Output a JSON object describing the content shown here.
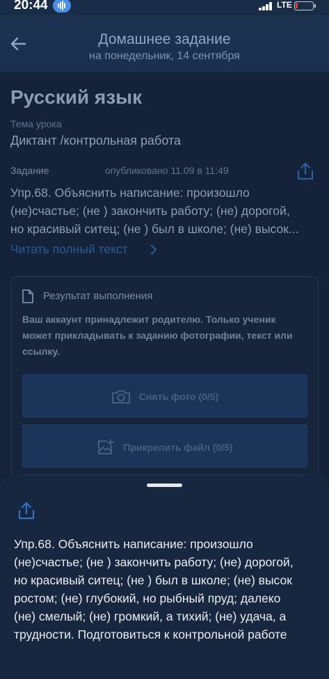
{
  "status": {
    "time": "20:44",
    "network": "LTE"
  },
  "header": {
    "title": "Домашнее задание",
    "subtitle": "на понедельник, 14 сентября"
  },
  "lesson": {
    "subject": "Русский язык",
    "topic_label": "Тема урока",
    "topic": "Диктант /контрольная работа",
    "task_label": "Задание",
    "published": "опубликовано 11.09 в 11:49",
    "preview_lines": [
      "Упр.68. Объяснить написание: произошло",
      "(не)счастье; (не ) закончить работу; (не) дорогой,",
      "но красивый ситец; (не ) был в школе; (не) высок..."
    ],
    "read_more": "Читать полный текст"
  },
  "result_card": {
    "title": "Результат выполнения",
    "notice": "Ваш аккаунт принадлежит родителю. Только ученик может прикладывать к заданию фотографии, текст или ссылку.",
    "photo_button": "Снять фото (0/5)",
    "file_button": "Прикрепить файл (0/5)"
  },
  "sheet": {
    "full_text_lines": [
      "Упр.68. Объяснить написание: произошло",
      "(не)счастье; (не ) закончить работу; (не) дорогой,",
      "но красивый ситец; (не ) был в школе; (не) высок",
      "ростом; (не) глубокий, но рыбный пруд; далеко",
      "(не) смелый; (не) громкий, а тихий; (не) удача, а",
      "трудности. Подготовиться к контрольной работе"
    ]
  },
  "icons": {
    "back": "arrow-left-icon",
    "share": "share-icon",
    "chevron": "chevron-right-icon",
    "document": "document-icon",
    "camera": "camera-icon",
    "attach": "image-attach-icon"
  },
  "colors": {
    "accent": "#2f73c9",
    "battery_low": "#e23b3b",
    "sheet_bg": "#17273f"
  }
}
